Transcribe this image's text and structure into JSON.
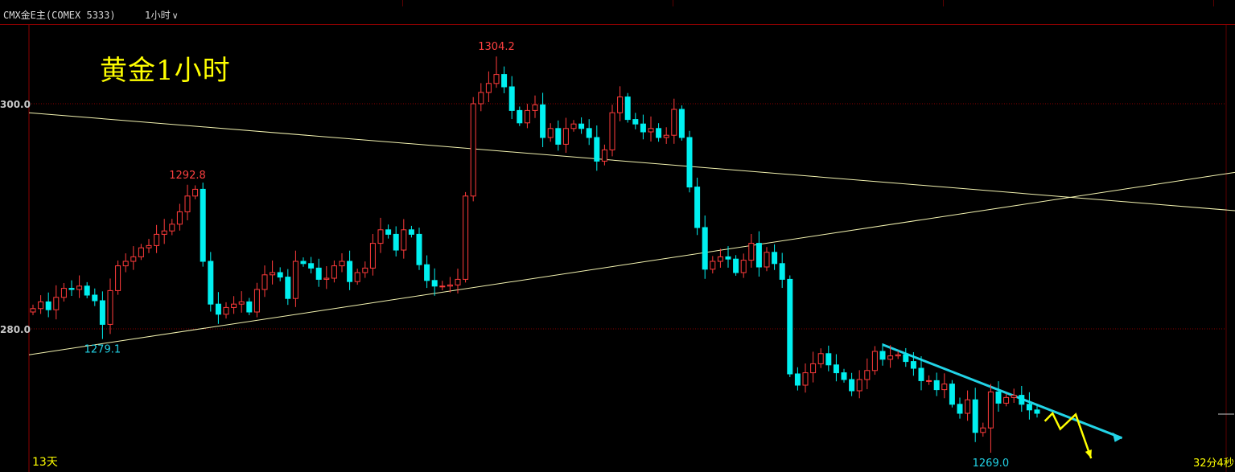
{
  "header": {
    "symbol": "CMX金E主(COMEX 5333)",
    "period": "1小时",
    "period_dropdown_icon": "chevron-down-icon"
  },
  "overlay_title": "黄金1小时",
  "footer": {
    "span_label": "13天",
    "countdown": "32分4秒"
  },
  "colors": {
    "up": "#ff3b3b",
    "down": "#00f0f0",
    "trend": "#f3f3b0",
    "annotation": "#ffff00",
    "grid": "#8b0000",
    "axis_text": "#c8c8c8"
  },
  "chart_data": {
    "type": "candlestick",
    "title": "黄金1小时",
    "y_axis_ticks": [
      "300.0",
      "280.0"
    ],
    "y_tick_values": [
      1300,
      1280
    ],
    "x_span": "13天",
    "annotations": [
      {
        "label": "1292.8",
        "value": 1292.8,
        "bar": 20,
        "kind": "high"
      },
      {
        "label": "1304.2",
        "value": 1304.2,
        "bar": 60,
        "kind": "high"
      },
      {
        "label": "1279.1",
        "value": 1279.1,
        "bar": 9,
        "kind": "low"
      },
      {
        "label": "1269.0",
        "value": 1269.0,
        "bar": 124,
        "kind": "low"
      }
    ],
    "trend_lines": [
      {
        "name": "resistance",
        "from": [
          0,
          1299.2
        ],
        "to": [
          145,
          1290.5
        ]
      },
      {
        "name": "support",
        "from": [
          0,
          1277.7
        ],
        "to": [
          145,
          1293.9
        ]
      },
      {
        "name": "short-term-down",
        "from": [
          110,
          1278.6
        ],
        "to": [
          141,
          1270.3
        ],
        "arrow": true
      }
    ],
    "projected_path": [
      [
        131,
        1271.8
      ],
      [
        132,
        1272.5
      ],
      [
        133,
        1271.1
      ],
      [
        135,
        1272.4
      ],
      [
        137,
        1268.5
      ]
    ],
    "closes": [
      1281.8,
      1282.4,
      1281.7,
      1282.8,
      1283.6,
      1283.5,
      1283.8,
      1283.0,
      1282.5,
      1280.4,
      1283.4,
      1285.6,
      1286.0,
      1286.4,
      1287.2,
      1287.4,
      1288.4,
      1288.7,
      1289.3,
      1290.4,
      1291.8,
      1292.4,
      1286.0,
      1282.2,
      1281.3,
      1281.9,
      1282.2,
      1282.4,
      1281.5,
      1283.5,
      1284.8,
      1285.0,
      1284.6,
      1282.7,
      1286.0,
      1285.8,
      1285.4,
      1284.4,
      1284.5,
      1285.6,
      1286.0,
      1284.2,
      1285.0,
      1285.4,
      1287.6,
      1288.8,
      1288.4,
      1287.0,
      1288.8,
      1288.4,
      1285.7,
      1284.3,
      1283.8,
      1283.8,
      1283.9,
      1284.4,
      1291.8,
      1300.0,
      1301.0,
      1301.8,
      1302.6,
      1301.5,
      1299.4,
      1298.3,
      1299.4,
      1299.9,
      1297.0,
      1297.8,
      1296.4,
      1297.8,
      1298.2,
      1297.8,
      1297.0,
      1294.9,
      1295.9,
      1299.2,
      1300.6,
      1298.6,
      1298.2,
      1297.5,
      1297.8,
      1297.0,
      1297.2,
      1299.5,
      1297.0,
      1292.6,
      1289.0,
      1285.3,
      1286.0,
      1286.4,
      1286.2,
      1285.0,
      1286.1,
      1287.6,
      1285.5,
      1286.8,
      1285.8,
      1284.4,
      1276.0,
      1275.0,
      1276.1,
      1276.9,
      1277.8,
      1276.8,
      1276.1,
      1275.5,
      1274.5,
      1275.5,
      1276.3,
      1278.0,
      1277.3,
      1277.6,
      1277.7,
      1277.1,
      1276.5,
      1275.4,
      1275.4,
      1274.6,
      1275.1,
      1273.3,
      1272.5,
      1273.7,
      1270.8,
      1271.2,
      1274.4,
      1273.4,
      1273.9,
      1274.1,
      1273.3,
      1272.8,
      1272.5
    ]
  }
}
